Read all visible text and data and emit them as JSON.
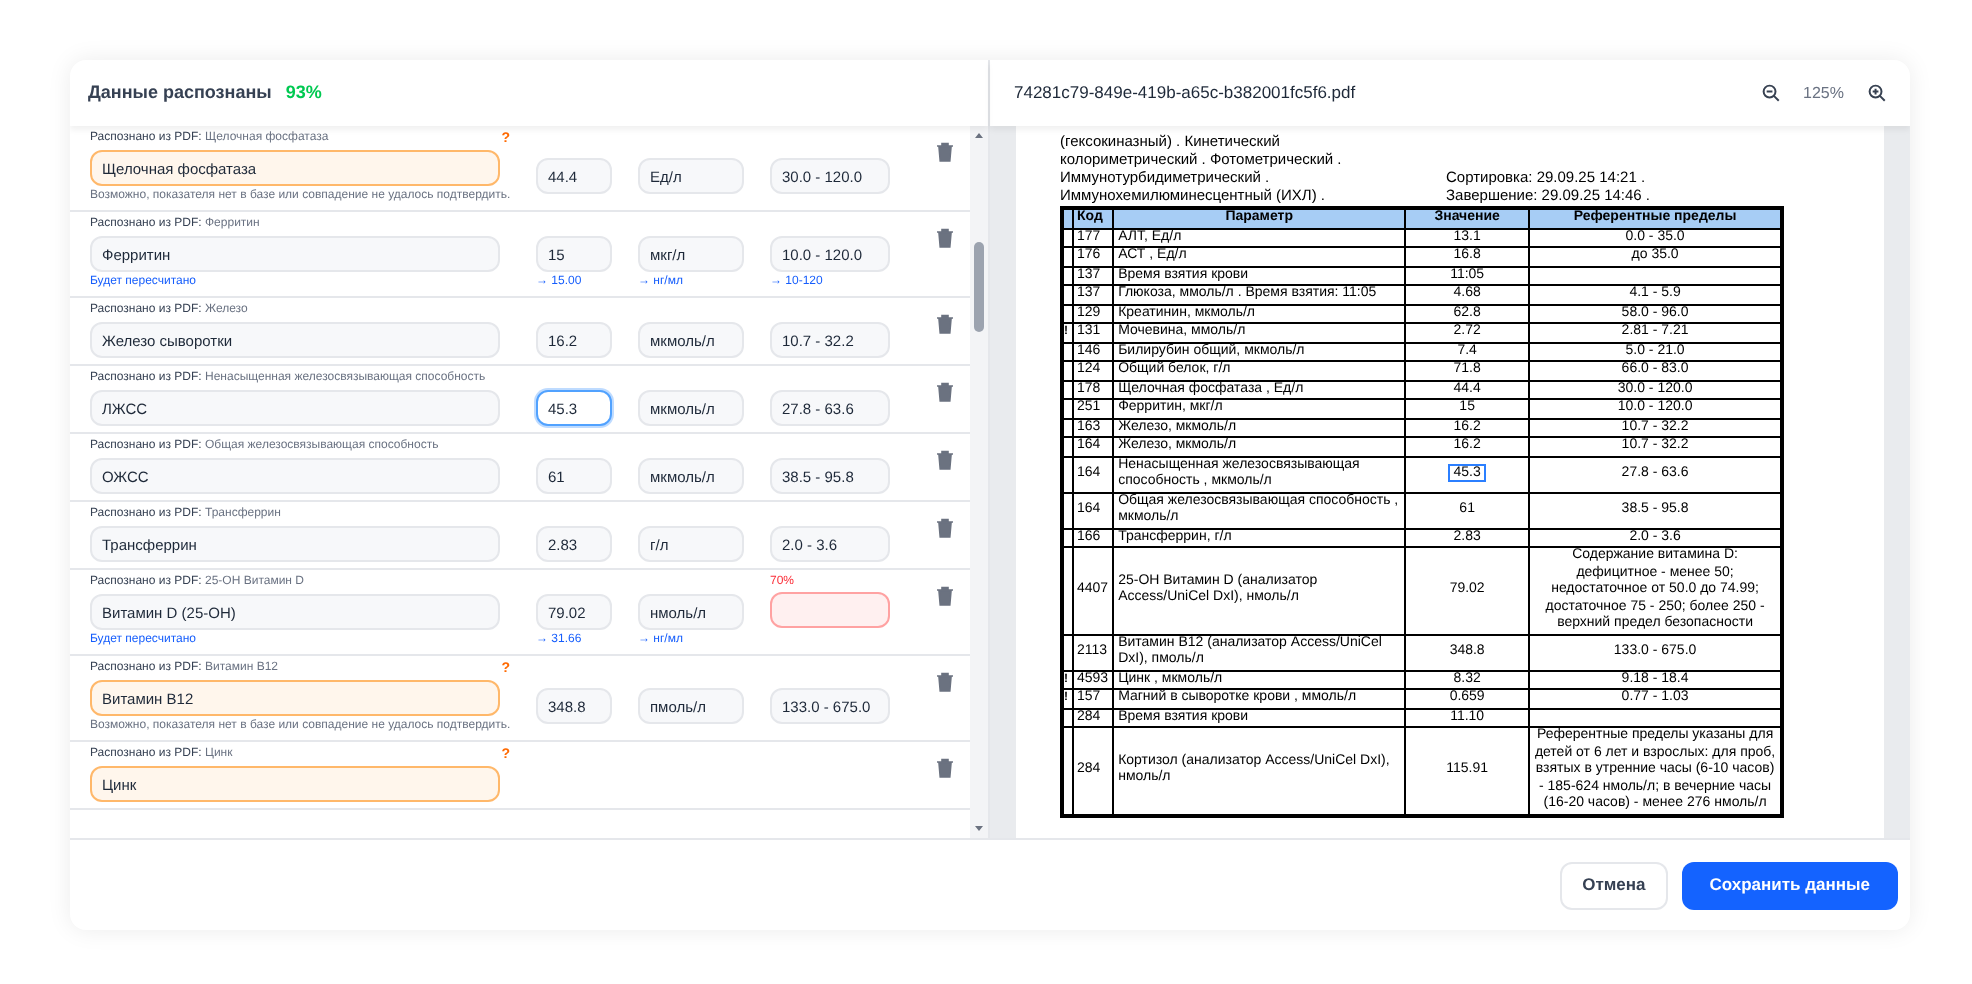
{
  "header": {
    "title": "Данные распознаны",
    "confidence": "93%"
  },
  "rows": [
    {
      "source_label": "Распознано из PDF:",
      "source": "Щелочная фосфатаза",
      "name": "Щелочная фосфатаза",
      "value": "44.4",
      "unit": "Ед/л",
      "range": "30.0 - 120.0",
      "uncertain": true,
      "mark": "?",
      "note": "Возможно, показателя нет в базе или совпадение не удалось подтвердить."
    },
    {
      "source_label": "Распознано из PDF:",
      "source": "Ферритин",
      "name": "Ферритин",
      "value": "15",
      "unit": "мкг/л",
      "range": "10.0 - 120.0",
      "uncertain": false,
      "recalc": {
        "note": "Будет пересчитано",
        "value": "→ 15.00",
        "unit": "→ нг/мл",
        "range": "→ 10-120"
      }
    },
    {
      "source_label": "Распознано из PDF:",
      "source": "Железо",
      "name": "Железо сыворотки",
      "value": "16.2",
      "unit": "мкмоль/л",
      "range": "10.7 - 32.2",
      "uncertain": false
    },
    {
      "source_label": "Распознано из PDF:",
      "source": "Ненасыщенная железосвязывающая способность",
      "name": "ЛЖСС",
      "value": "45.3",
      "unit": "мкмоль/л",
      "range": "27.8 - 63.6",
      "uncertain": false,
      "focused": true
    },
    {
      "source_label": "Распознано из PDF:",
      "source": "Общая железосвязывающая способность",
      "name": "ОЖСС",
      "value": "61",
      "unit": "мкмоль/л",
      "range": "38.5 - 95.8",
      "uncertain": false
    },
    {
      "source_label": "Распознано из PDF:",
      "source": "Трансферрин",
      "name": "Трансферрин",
      "value": "2.83",
      "unit": "г/л",
      "range": "2.0 - 3.6",
      "uncertain": false
    },
    {
      "source_label": "Распознано из PDF:",
      "source": "25-OH Витамин D",
      "name": "Витамин D (25-OH)",
      "value": "79.02",
      "unit": "нмоль/л",
      "range_invalid": true,
      "range_badge": "70%",
      "uncertain": false,
      "recalc": {
        "note": "Будет пересчитано",
        "value": "→ 31.66",
        "unit": "→ нг/мл"
      }
    },
    {
      "source_label": "Распознано из PDF:",
      "source": "Витамин B12",
      "name": "Витамин B12",
      "value": "348.8",
      "unit": "пмоль/л",
      "range": "133.0 - 675.0",
      "uncertain": true,
      "mark": "?",
      "note": "Возможно, показателя нет в базе или совпадение не удалось подтвердить."
    },
    {
      "source_label": "Распознано из PDF:",
      "source": "Цинк",
      "name": "Цинк",
      "uncertain": true,
      "mark": "?"
    }
  ],
  "pdf": {
    "filename": "74281c79-849e-419b-a65c-b382001fc5f6.pdf",
    "zoom": "125%",
    "intro_lines": [
      "(гексокиназный) . Кинетический",
      "колориметрический . Фотометрический .",
      "Иммунотурбидиметрический .",
      "Иммунохемилюминесцентный (ИХЛ) ."
    ],
    "side_lines": [
      "Сортировка: 29.09.25 14:21 .",
      "Завершение: 29.09.25 14:46 ."
    ],
    "columns": [
      "Код",
      "Параметр",
      "Значение",
      "Референтные пределы"
    ],
    "rows": [
      {
        "flag": "",
        "code": "177",
        "param": "АЛТ, Ед/л",
        "value": "13.1",
        "range": "0.0 - 35.0"
      },
      {
        "flag": "",
        "code": "176",
        "param": "АСТ , Ед/л",
        "value": "16.8",
        "range": "до 35.0"
      },
      {
        "flag": "",
        "code": "137",
        "param": "Время взятия крови",
        "value": "11:05",
        "range": ""
      },
      {
        "flag": "",
        "code": "137",
        "param": "Глюкоза, ммоль/л . Время взятия: 11:05",
        "value": "4.68",
        "range": "4.1 - 5.9"
      },
      {
        "flag": "",
        "code": "129",
        "param": "Креатинин, мкмоль/л",
        "value": "62.8",
        "range": "58.0 - 96.0"
      },
      {
        "flag": "!",
        "code": "131",
        "param": "Мочевина, ммоль/л",
        "value": "2.72",
        "range": "2.81 - 7.21"
      },
      {
        "flag": "",
        "code": "146",
        "param": "Билирубин общий, мкмоль/л",
        "value": "7.4",
        "range": "5.0 - 21.0"
      },
      {
        "flag": "",
        "code": "124",
        "param": "Общий белок, г/л",
        "value": "71.8",
        "range": "66.0 - 83.0"
      },
      {
        "flag": "",
        "code": "178",
        "param": "Щелочная фосфатаза , Ед/л",
        "value": "44.4",
        "range": "30.0 - 120.0"
      },
      {
        "flag": "",
        "code": "251",
        "param": "Ферритин, мкг/л",
        "value": "15",
        "range": "10.0 - 120.0"
      },
      {
        "flag": "",
        "code": "163",
        "param": "Железо, мкмоль/л",
        "value": "16.2",
        "range": "10.7 - 32.2"
      },
      {
        "flag": "",
        "code": "164",
        "param": "Железо, мкмоль/л",
        "value": "16.2",
        "range": "10.7 - 32.2"
      },
      {
        "flag": "",
        "code": "164",
        "param": "Ненасыщенная железосвязывающая способность , мкмоль/л",
        "value": "45.3",
        "range": "27.8 - 63.6",
        "selected": true
      },
      {
        "flag": "",
        "code": "164",
        "param": "Общая железосвязывающая способность , мкмоль/л",
        "value": "61",
        "range": "38.5 - 95.8"
      },
      {
        "flag": "",
        "code": "166",
        "param": "Трансферрин, г/л",
        "value": "2.83",
        "range": "2.0 - 3.6"
      },
      {
        "flag": "",
        "code": "4407",
        "param": "25-OH Витамин D (анализатор Access/UniCel DxI), нмоль/л",
        "value": "79.02",
        "range": "Содержание витамина D: дефицитное - менее 50; недостаточное от 50.0 до 74.99; достаточное 75 - 250; более 250 - верхний предел безопасности"
      },
      {
        "flag": "",
        "code": "2113",
        "param": "Витамин B12 (анализатор Access/UniCel DxI), пмоль/л",
        "value": "348.8",
        "range": "133.0 - 675.0"
      },
      {
        "flag": "!",
        "code": "4593",
        "param": "Цинк , мкмоль/л",
        "value": "8.32",
        "range": "9.18 - 18.4"
      },
      {
        "flag": "!",
        "code": "157",
        "param": "Магний в сыворотке крови , ммоль/л",
        "value": "0.659",
        "range": "0.77 - 1.03"
      },
      {
        "flag": "",
        "code": "284",
        "param": "Время взятия крови",
        "value": "11.10",
        "range": ""
      },
      {
        "flag": "",
        "code": "284",
        "param": "Кортизол (анализатор Access/UniCel DxI), нмоль/л",
        "value": "115.91",
        "range": "Референтные пределы указаны для детей от 6 лет и взрослых: для проб, взятых в утренние часы (6-10 часов) - 185-624 нмоль/л; в вечерние часы (16-20 часов) - менее 276 нмоль/л"
      }
    ]
  },
  "footer": {
    "cancel": "Отмена",
    "save": "Сохранить данные"
  }
}
